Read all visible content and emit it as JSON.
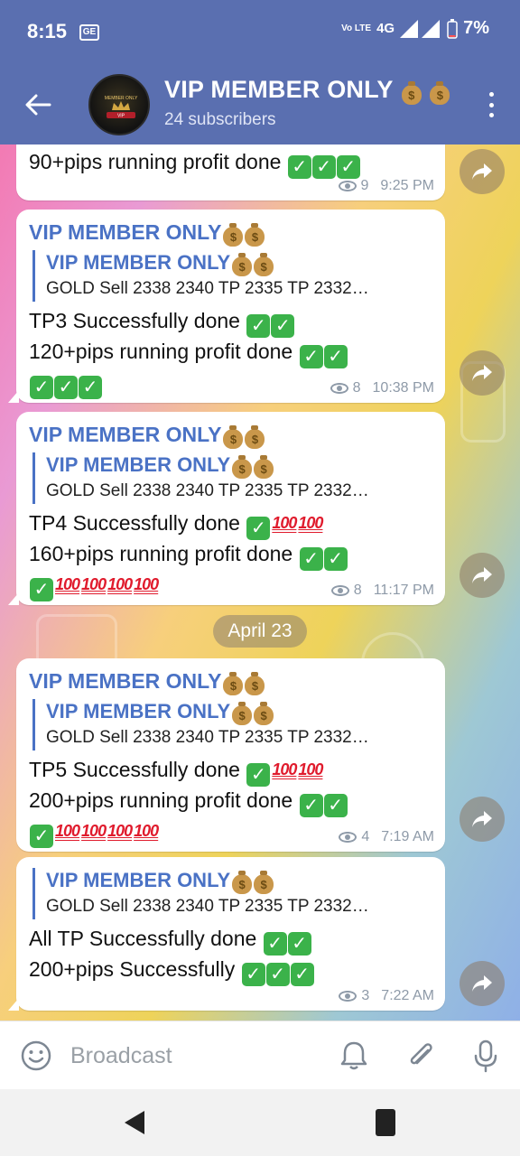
{
  "status_bar": {
    "time": "8:15",
    "notification_badge": "GE",
    "volte": "Vo LTE",
    "network": "4G",
    "battery": "7%"
  },
  "header": {
    "title": "VIP MEMBER ONLY",
    "subtitle": "24 subscribers",
    "avatar_text": "VIP MEMBER ONLY"
  },
  "messages": [
    {
      "line1": "90+pips running profit done",
      "views": "9",
      "time": "9:25 PM"
    },
    {
      "channel": "VIP MEMBER ONLY",
      "forward_from": "VIP MEMBER ONLY",
      "forward_text": "GOLD Sell 2338 2340  TP  2335 TP  2332…",
      "line1": "TP3 Successfully done",
      "line2": "120+pips running profit done",
      "views": "8",
      "time": "10:38 PM"
    },
    {
      "channel": "VIP MEMBER ONLY",
      "forward_from": "VIP MEMBER ONLY",
      "forward_text": "GOLD Sell 2338 2340  TP  2335 TP  2332…",
      "line1": "TP4 Successfully done",
      "line2": "160+pips running profit done",
      "views": "8",
      "time": "11:17 PM"
    },
    {
      "channel": "VIP MEMBER ONLY",
      "forward_from": "VIP MEMBER ONLY",
      "forward_text": "GOLD Sell 2338 2340  TP  2335 TP  2332…",
      "line1": "TP5 Successfully done",
      "line2": "200+pips running profit done",
      "views": "4",
      "time": "7:19 AM"
    },
    {
      "forward_from": "VIP MEMBER ONLY",
      "forward_text": "GOLD Sell 2338 2340  TP  2335 TP  2332…",
      "line1": "All TP Successfully done",
      "line2": "200+pips Successfully",
      "views": "3",
      "time": "7:22 AM"
    }
  ],
  "date_divider": "April 23",
  "emoji": {
    "check": "✓",
    "hundred": "100",
    "money_bag": "$"
  },
  "input": {
    "placeholder": "Broadcast"
  },
  "icons": {
    "back": "arrow-left-icon",
    "menu": "more-vertical-icon",
    "share": "share-arrow-icon",
    "emoji": "smiley-icon",
    "bell": "bell-icon",
    "attach": "paperclip-icon",
    "mic": "microphone-icon"
  },
  "colors": {
    "header_bg": "#5a6fb0",
    "channel_name": "#4a72c5",
    "check_green": "#3bb24a",
    "hundred_red": "#e01b2d"
  }
}
